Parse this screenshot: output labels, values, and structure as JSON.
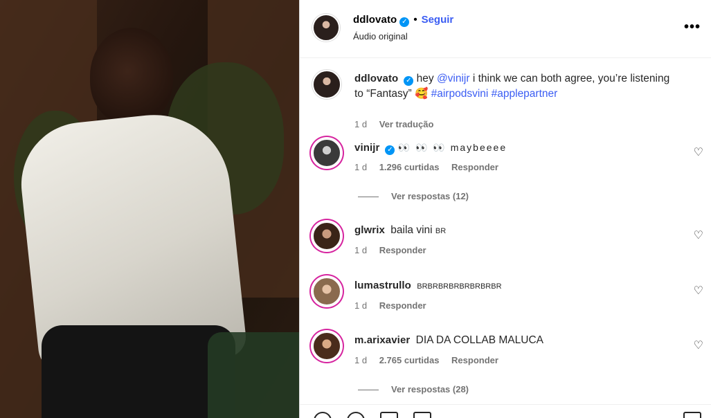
{
  "post": {
    "author": "ddlovato",
    "follow_label": "Seguir",
    "audio": "Áudio original",
    "more_label": "•••"
  },
  "caption": {
    "username": "ddlovato",
    "text_before": "hey ",
    "mention": "@vinijr",
    "text_middle": " i think we can both agree, you’re listening to “Fantasy” ",
    "emoji": "🥰",
    "hashtags": " #airpodsvini #applepartner",
    "time": "1 d",
    "translate": "Ver tradução"
  },
  "comments": [
    {
      "username": "vinijr",
      "verified": true,
      "text": "👀 👀 👀 maybeeee",
      "time": "1 d",
      "likes": "1.296 curtidas",
      "reply": "Responder",
      "view_replies": "Ver respostas (12)"
    },
    {
      "username": "glwrix",
      "text": "baila vini",
      "flag": "BR",
      "time": "1 d",
      "reply": "Responder"
    },
    {
      "username": "lumastrullo",
      "flag": "BRBRBRBRBRBRBRBR",
      "time": "1 d",
      "reply": "Responder"
    },
    {
      "username": "m.arixavier",
      "text": "DIA DA COLLAB MALUCA",
      "time": "1 d",
      "likes": "2.765 curtidas",
      "reply": "Responder",
      "view_replies": "Ver respostas (28)"
    }
  ],
  "icons": {
    "verified": "verified-badge-icon",
    "heart": "heart-icon",
    "more": "more-options-icon"
  },
  "colors": {
    "link": "#3b5df3",
    "verified": "#0095f6",
    "muted": "#737373",
    "story_ring": "#d6249f"
  }
}
